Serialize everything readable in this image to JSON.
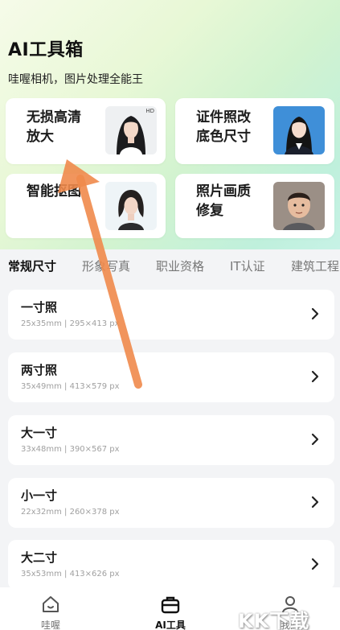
{
  "header": {
    "title": "AI工具箱",
    "subtitle": "哇喔相机，图片处理全能王"
  },
  "tool_cards": [
    {
      "label": "无损高清\n放大",
      "badge": "HD"
    },
    {
      "label": "证件照改\n底色尺寸"
    },
    {
      "label": "智能抠图"
    },
    {
      "label": "照片画质\n修复"
    }
  ],
  "tabs": [
    "常规尺寸",
    "形象写真",
    "职业资格",
    "IT认证",
    "建筑工程"
  ],
  "active_tab": "常规尺寸",
  "size_list": [
    {
      "name": "一寸照",
      "spec": "25x35mm | 295×413 px"
    },
    {
      "name": "两寸照",
      "spec": "35x49mm | 413×579 px"
    },
    {
      "name": "大一寸",
      "spec": "33x48mm | 390×567 px"
    },
    {
      "name": "小一寸",
      "spec": "22x32mm | 260×378 px"
    },
    {
      "name": "大二寸",
      "spec": "35x53mm | 413×626 px"
    }
  ],
  "bottom_nav": [
    {
      "label": "哇喔",
      "icon": "home-icon"
    },
    {
      "label": "AI工具",
      "icon": "toolbox-icon"
    },
    {
      "label": "我的",
      "icon": "profile-icon"
    }
  ],
  "watermark": "KK下载",
  "colors": {
    "accent_arrow": "#f08a4b",
    "hero_gradient_start": "#f6fbe9",
    "hero_gradient_end": "#bff0dc",
    "active_text": "#111111",
    "inactive_text": "#777777"
  }
}
